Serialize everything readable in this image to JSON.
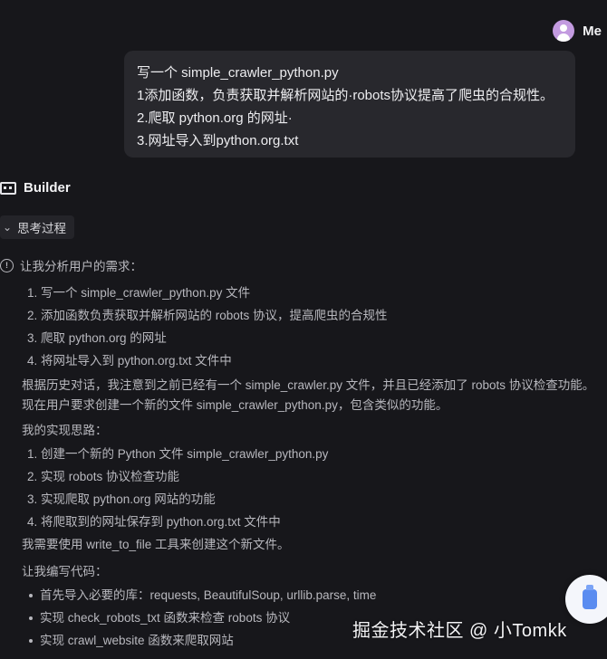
{
  "user": {
    "name": "Me",
    "avatar_icon": "user-avatar-icon"
  },
  "message": {
    "lines": [
      "写一个 simple_crawler_python.py",
      "1添加函数，负责获取并解析网站的·robots协议提高了爬虫的合规性。",
      "2.爬取 python.org 的网址·",
      "3.网址导入到python.org.txt"
    ]
  },
  "assistant": {
    "name": "Builder",
    "icon": "builder-icon"
  },
  "thinking": {
    "toggle_label": "思考过程",
    "intro": "让我分析用户的需求：",
    "requirements": [
      "1. 写一个 simple_crawler_python.py 文件",
      "2. 添加函数负责获取并解析网站的 robots 协议，提高爬虫的合规性",
      "3. 爬取 python.org 的网址",
      "4. 将网址导入到 python.org.txt 文件中"
    ],
    "history_note": "根据历史对话，我注意到之前已经有一个 simple_crawler.py 文件，并且已经添加了 robots 协议检查功能。现在用户要求创建一个新的文件 simple_crawler_python.py，包含类似的功能。",
    "approach_title": "我的实现思路：",
    "steps": [
      "1. 创建一个新的 Python 文件 simple_crawler_python.py",
      "2. 实现 robots 协议检查功能",
      "3. 实现爬取 python.org 网站的功能",
      "4. 将爬取到的网址保存到 python.org.txt 文件中"
    ],
    "tool_note": "我需要使用 write_to_file 工具来创建这个新文件。",
    "code_title": "让我编写代码：",
    "code_points": [
      "首先导入必要的库：requests, BeautifulSoup, urllib.parse, time",
      "实现 check_robots_txt 函数来检查 robots 协议",
      "实现 crawl_website 函数来爬取网站"
    ]
  },
  "watermark": "掘金技术社区 @ 小Tomkk"
}
